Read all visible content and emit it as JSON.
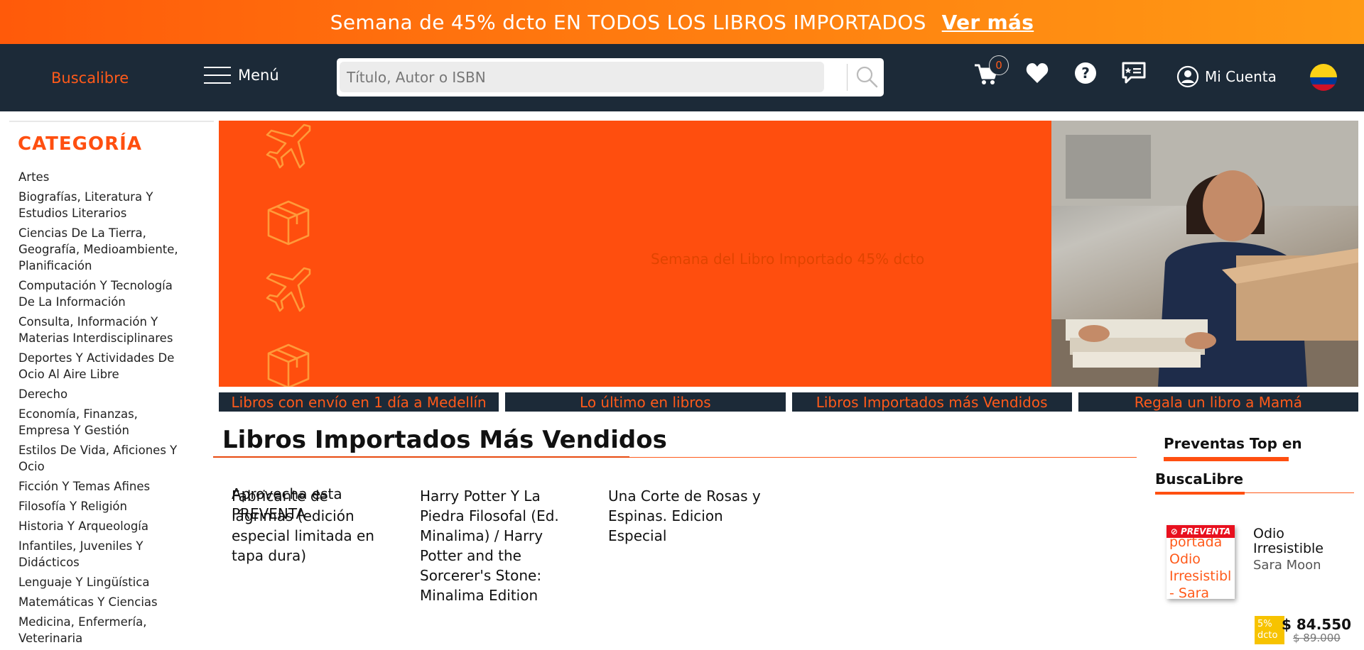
{
  "promo": {
    "text": "Semana de 45% dcto EN TODOS LOS LIBROS IMPORTADOS",
    "link": "Ver más"
  },
  "header": {
    "logo": "Buscalibre",
    "menu_label": "Menú",
    "search_placeholder": "Título, Autor o ISBN",
    "cart_count": "0",
    "account_label": "Mi Cuenta",
    "icons": [
      "search-icon",
      "cart-icon",
      "heart-icon",
      "help-icon",
      "chat-icon",
      "user-icon",
      "colombia-flag-icon"
    ]
  },
  "sidebar": {
    "title": "CATEGORÍA",
    "items": [
      "Artes",
      "Biografías, Literatura Y Estudios Literarios",
      "Ciencias De La Tierra, Geografía, Medioambiente, Planificación",
      "Computación Y Tecnología De La Información",
      "Consulta, Información Y Materias Interdisciplinares",
      "Deportes Y Actividades De Ocio Al Aire Libre",
      "Derecho",
      "Economía, Finanzas, Empresa Y Gestión",
      "Estilos De Vida, Aficiones Y Ocio",
      "Ficción Y Temas Afines",
      "Filosofía Y Religión",
      "Historia Y Arqueología",
      "Infantiles, Juveniles Y Didácticos",
      "Lenguaje Y Lingüística",
      "Matemáticas Y Ciencias",
      "Medicina, Enfermería, Veterinaria"
    ]
  },
  "banner": {
    "alt_text": "Semana del Libro Importado 45% dcto",
    "links": [
      "Libros con envío en 1 día a Medellín",
      "Lo último en libros",
      "Libros Importados más Vendidos",
      "Regala un libro a Mamá"
    ]
  },
  "bestsellers": {
    "title": "Libros Importados Más Vendidos",
    "products": [
      {
        "title": "Fabricante de lágrimas (edición especial limitada en tapa dura)",
        "overlay": "Aprovecha esta PREVENTA"
      },
      {
        "title": "Harry Potter Y La Piedra Filosofal (Ed. Minalima) / Harry Potter and the Sorcerer's Stone: Minalima Edition"
      },
      {
        "title": "Una Corte de Rosas y Espinas. Edicion Especial"
      }
    ]
  },
  "preventas": {
    "title_line1": "Preventas Top en",
    "title_line2": "BuscaLibre",
    "item": {
      "tag": "⊘ PREVENTA",
      "cover_alt": "portada Odio Irresistibl - Sara",
      "title": "Odio Irresistible",
      "author": "Sara Moon",
      "discount": "5% dcto",
      "price": "$ 84.550",
      "old_price": "$ 89.000"
    }
  },
  "colors": {
    "brand_orange": "#ff5a1a",
    "banner_orange": "#ff4e0e",
    "header_navy": "#1c2a38"
  }
}
